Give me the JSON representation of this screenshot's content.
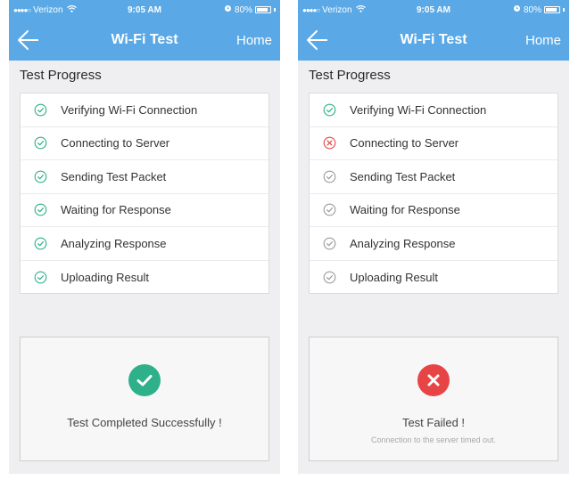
{
  "colors": {
    "accent": "#5aa9e6",
    "success": "#2eb08a",
    "failure": "#e74545",
    "pending": "#9a9a9a"
  },
  "screens": [
    {
      "status_bar": {
        "carrier": "Verizon",
        "time": "9:05 AM",
        "battery": "80%"
      },
      "nav": {
        "back_icon": "arrow-left-icon",
        "title": "Wi-Fi Test",
        "home_label": "Home"
      },
      "section_title": "Test Progress",
      "steps": [
        {
          "label": "Verifying Wi-Fi Connection",
          "state": "success"
        },
        {
          "label": "Connecting to Server",
          "state": "success"
        },
        {
          "label": "Sending Test Packet",
          "state": "success"
        },
        {
          "label": "Waiting for Response",
          "state": "success"
        },
        {
          "label": "Analyzing Response",
          "state": "success"
        },
        {
          "label": "Uploading Result",
          "state": "success"
        }
      ],
      "result": {
        "state": "success",
        "icon": "checkmark-circle-icon",
        "message": "Test Completed Successfully !",
        "detail": ""
      }
    },
    {
      "status_bar": {
        "carrier": "Verizon",
        "time": "9:05 AM",
        "battery": "80%"
      },
      "nav": {
        "back_icon": "arrow-left-icon",
        "title": "Wi-Fi Test",
        "home_label": "Home"
      },
      "section_title": "Test Progress",
      "steps": [
        {
          "label": "Verifying Wi-Fi Connection",
          "state": "success"
        },
        {
          "label": "Connecting to Server",
          "state": "failure"
        },
        {
          "label": "Sending Test Packet",
          "state": "pending"
        },
        {
          "label": "Waiting for Response",
          "state": "pending"
        },
        {
          "label": "Analyzing Response",
          "state": "pending"
        },
        {
          "label": "Uploading Result",
          "state": "pending"
        }
      ],
      "result": {
        "state": "failure",
        "icon": "x-circle-icon",
        "message": "Test Failed !",
        "detail": "Connection to the server timed out."
      }
    }
  ]
}
